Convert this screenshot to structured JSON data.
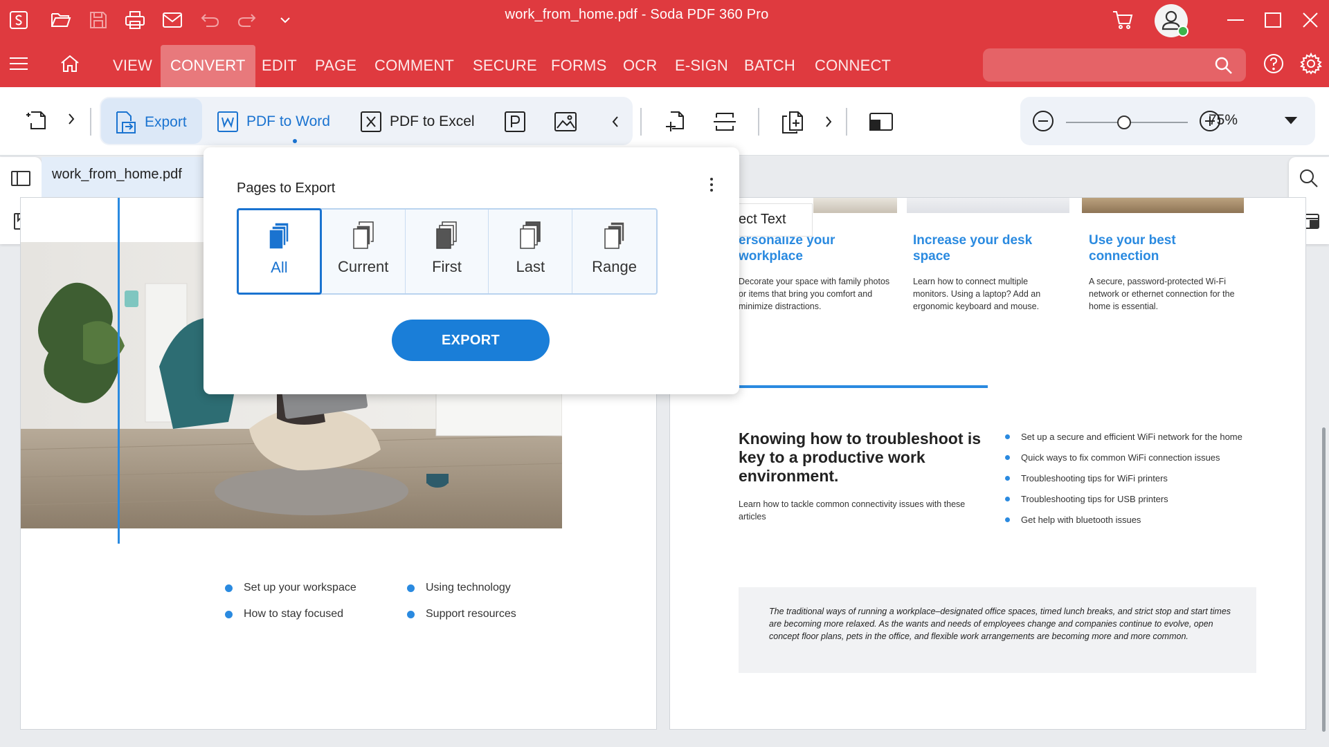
{
  "window": {
    "title": "work_from_home.pdf   -   Soda PDF 360 Pro"
  },
  "quick_access": {
    "icons": [
      "app-logo-icon",
      "open-folder-icon",
      "save-icon",
      "print-icon",
      "email-icon",
      "undo-icon",
      "redo-icon",
      "chevron-down-icon"
    ]
  },
  "menu": {
    "items": [
      "VIEW",
      "CONVERT",
      "EDIT",
      "PAGE",
      "COMMENT",
      "SECURE",
      "FORMS",
      "OCR",
      "E-SIGN",
      "BATCH",
      "CONNECT"
    ],
    "active": "CONVERT",
    "search_placeholder": ""
  },
  "toolbar": {
    "export_label": "Export",
    "pdf_to_word_label": "PDF to Word",
    "pdf_to_excel_label": "PDF to Excel",
    "zoom_value": "75%",
    "zoom_level": 0.5
  },
  "document": {
    "tab_name": "work_from_home.pdf"
  },
  "popup": {
    "title": "Pages to Export",
    "options": [
      "All",
      "Current",
      "First",
      "Last",
      "Range"
    ],
    "selected": "All",
    "button_label": "EXPORT"
  },
  "left_page": {
    "bullets": [
      "Set up your workspace",
      "How to stay focused",
      "Using technology",
      "Support resources"
    ]
  },
  "right_page": {
    "tooltip_text": "ect Text",
    "columns": [
      {
        "heading": "Personalize your workplace",
        "heading_visible": "ersonalize your\nworkplace",
        "text": "Decorate your space with family photos or items that bring you comfort and minimize distractions."
      },
      {
        "heading": "Increase your desk space",
        "text": "Learn how to connect multiple monitors.  Using a laptop? Add an ergonomic keyboard and mouse."
      },
      {
        "heading": "Use your best connection",
        "text": "A secure, password-protected Wi-Fi network or ethernet connection for the home is essential."
      }
    ],
    "troubleshoot_heading": "Knowing how to troubleshoot is key to a productive work environment.",
    "troubleshoot_sub": "Learn how to tackle common connectivity issues with these articles",
    "troubleshoot_bullets": [
      "Set up a secure and efficient WiFi network for the home",
      "Quick ways to fix common WiFi connection issues",
      "Troubleshooting tips for WiFi printers",
      "Troubleshooting tips for USB printers",
      "Get help with bluetooth issues"
    ],
    "quote": "The traditional ways of running a workplace–designated office spaces, timed lunch breaks, and strict stop and start times are becoming more relaxed. As the wants and needs of employees change and companies continue to evolve, open concept floor plans, pets in the office, and flexible work arrangements are becoming more and more common."
  },
  "colors": {
    "brand_red": "#df3a3f",
    "accent_blue": "#1a73d0"
  }
}
